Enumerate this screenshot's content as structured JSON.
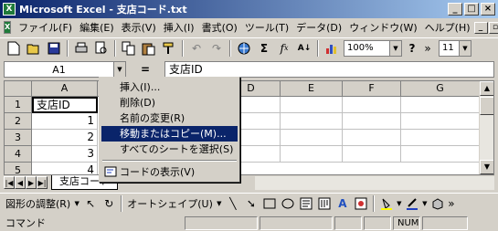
{
  "window": {
    "title": "Microsoft Excel - 支店コード.txt",
    "app_icon_glyph": "X",
    "buttons": {
      "minimize": "_",
      "maximize": "□",
      "close": "×"
    }
  },
  "menubar": {
    "items": [
      "ファイル(F)",
      "編集(E)",
      "表示(V)",
      "挿入(I)",
      "書式(O)",
      "ツール(T)",
      "データ(D)",
      "ウィンドウ(W)",
      "ヘルプ(H)"
    ],
    "mdi_buttons": {
      "minimize": "_",
      "restore": "▫",
      "close": "×"
    }
  },
  "toolbar": {
    "zoom": "100%",
    "font_size": "11",
    "more": "»"
  },
  "formula_bar": {
    "name_box": "A1",
    "equals": "=",
    "content": "支店ID"
  },
  "grid": {
    "columns": [
      "A",
      "D",
      "E",
      "F",
      "G"
    ],
    "rows": [
      "1",
      "2",
      "3",
      "4",
      "5"
    ],
    "cells": {
      "a1": "支店ID",
      "a2": "1",
      "a3": "2",
      "a4": "3",
      "a5": "4"
    }
  },
  "sheet_tabs": {
    "nav": [
      "|◀",
      "◀",
      "▶",
      "▶|"
    ],
    "active": "支店コード"
  },
  "context_menu": {
    "items": [
      {
        "label": "挿入(I)...",
        "highlighted": false
      },
      {
        "label": "削除(D)",
        "highlighted": false
      },
      {
        "label": "名前の変更(R)",
        "highlighted": false
      },
      {
        "label": "移動またはコピー(M)...",
        "highlighted": true
      },
      {
        "label": "すべてのシートを選択(S)",
        "highlighted": false
      }
    ],
    "view_code": "コードの表示(V)"
  },
  "drawing_toolbar": {
    "adjust": "図形の調整(R)",
    "autoshape": "オートシェイプ(U)"
  },
  "statusbar": {
    "status": "コマンド",
    "num": "NUM"
  },
  "colors": {
    "title_gradient_start": "#0a246a",
    "title_gradient_end": "#a6caf0",
    "chrome": "#d4d0c8",
    "highlight": "#0a246a"
  }
}
